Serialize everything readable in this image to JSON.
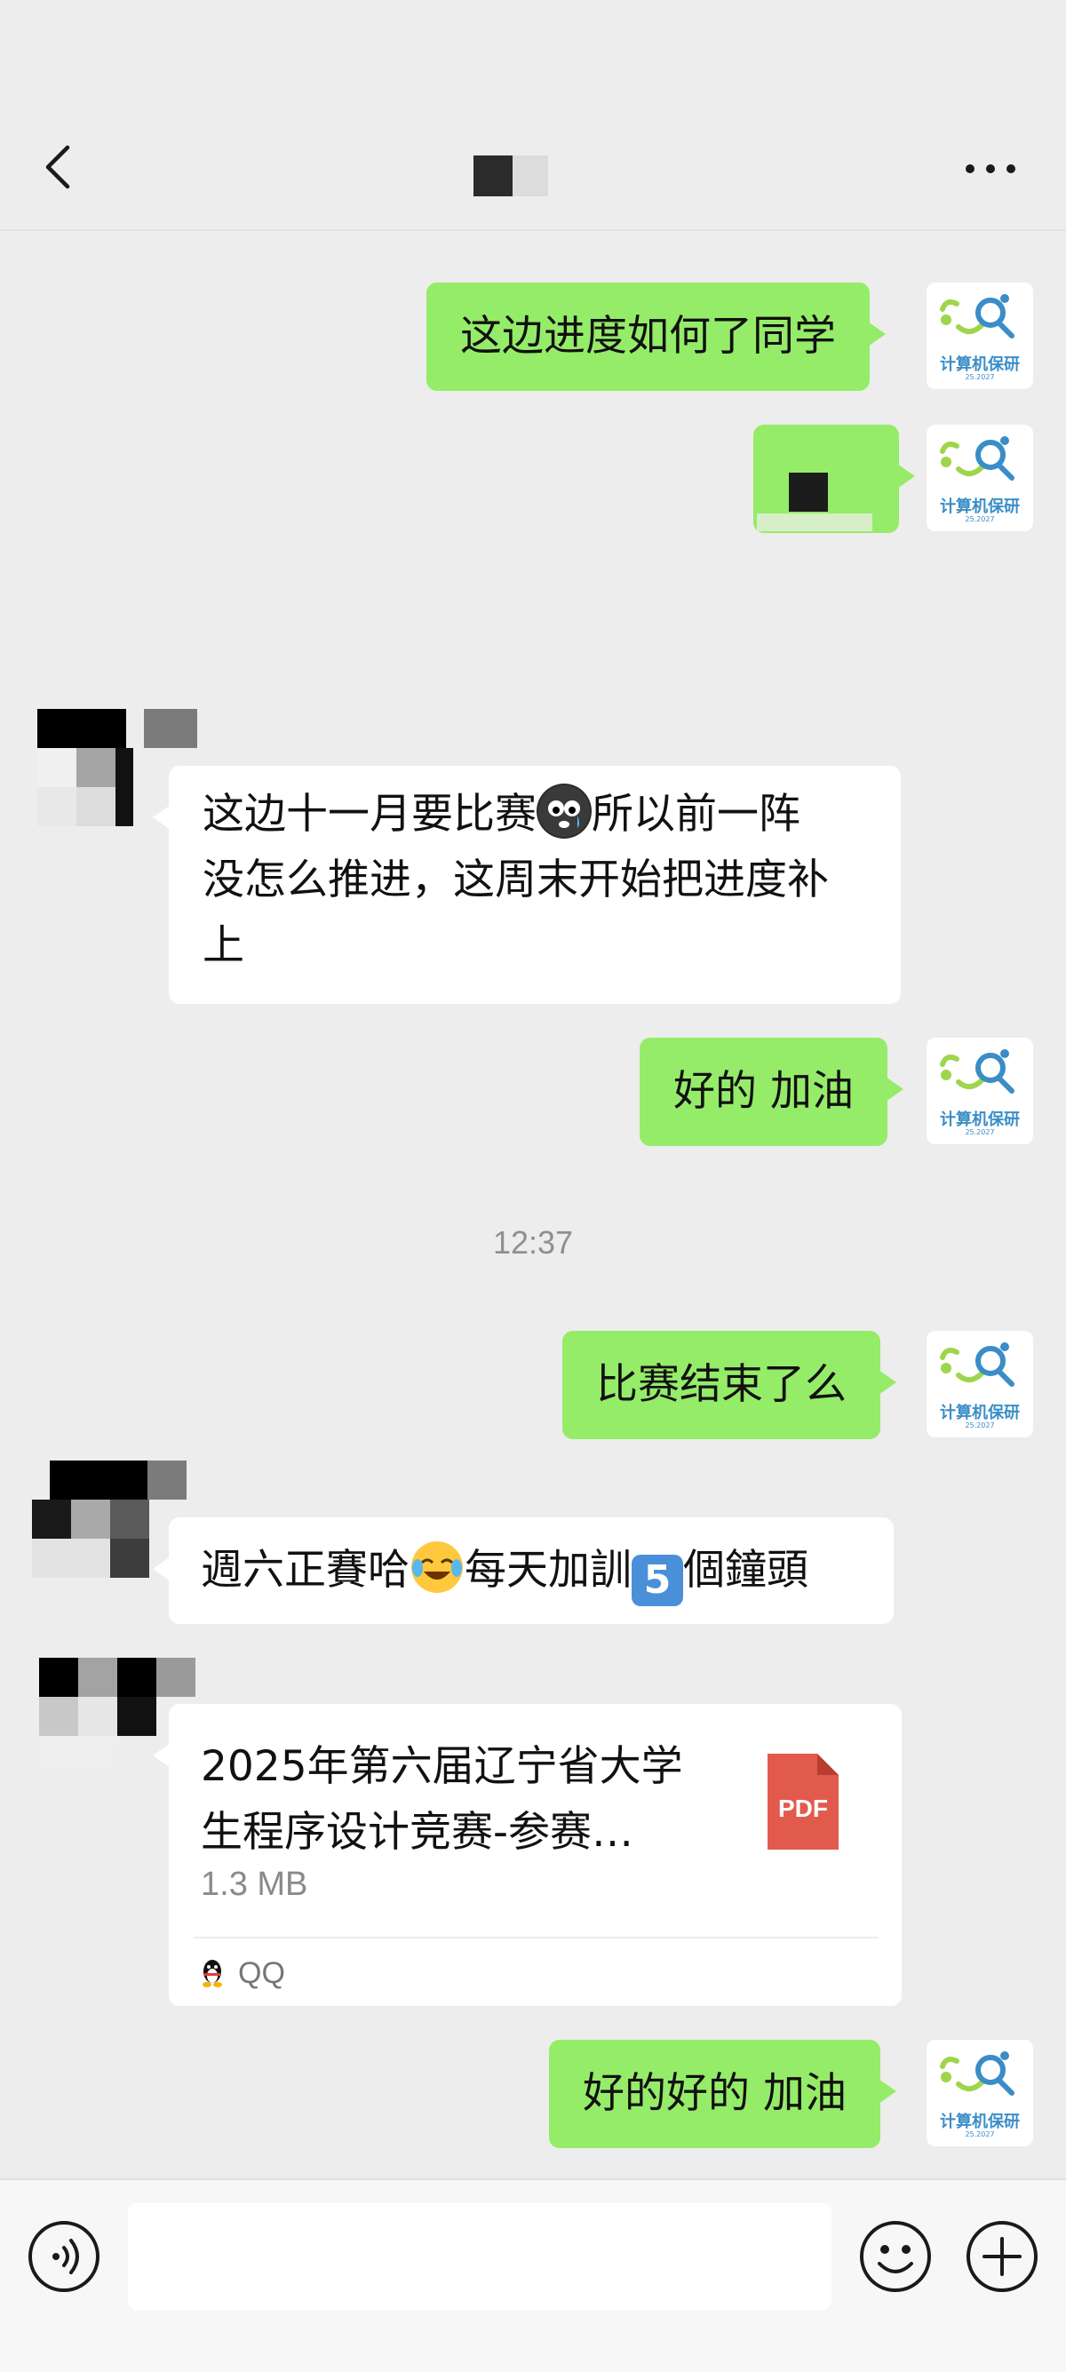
{
  "header": {
    "back_icon": "chevron-left-icon",
    "more_icon": "more-dots-icon"
  },
  "messages": [
    {
      "side": "out",
      "text": "这边进度如何了同学"
    },
    {
      "side": "out",
      "text": ""
    },
    {
      "side": "in",
      "lines": [
        "这边十一月要比赛",
        "所以前一阵",
        "没怎么推进，这周末开始把进度补",
        "上"
      ]
    },
    {
      "side": "out",
      "text": "好的 加油"
    },
    {
      "side": "out",
      "text": "比赛结束了么"
    },
    {
      "side": "in",
      "parts": [
        "週六正賽哈",
        "每天加訓",
        "5",
        "個鐘頭"
      ]
    },
    {
      "side": "out",
      "text": "好的好的 加油"
    }
  ],
  "timestamp": "12:37",
  "file": {
    "name_lines": [
      "2025年第六届辽宁省大学",
      "生程序设计竞赛-参赛…"
    ],
    "size": "1.3 MB",
    "icon_label": "PDF",
    "source": "QQ"
  },
  "my_avatar": {
    "label": "计算机保研",
    "sub": "25.2027"
  },
  "colors": {
    "background": "#ededed",
    "out_bubble": "#95ec69",
    "in_bubble": "#ffffff",
    "pdf_red": "#e25a4c",
    "avatar_blue": "#3a8dc7",
    "avatar_green": "#9ed64b"
  },
  "bottom_bar": {
    "voice_icon": "voice-icon",
    "emoji_icon": "emoji-icon",
    "plus_icon": "plus-icon",
    "input_value": ""
  }
}
